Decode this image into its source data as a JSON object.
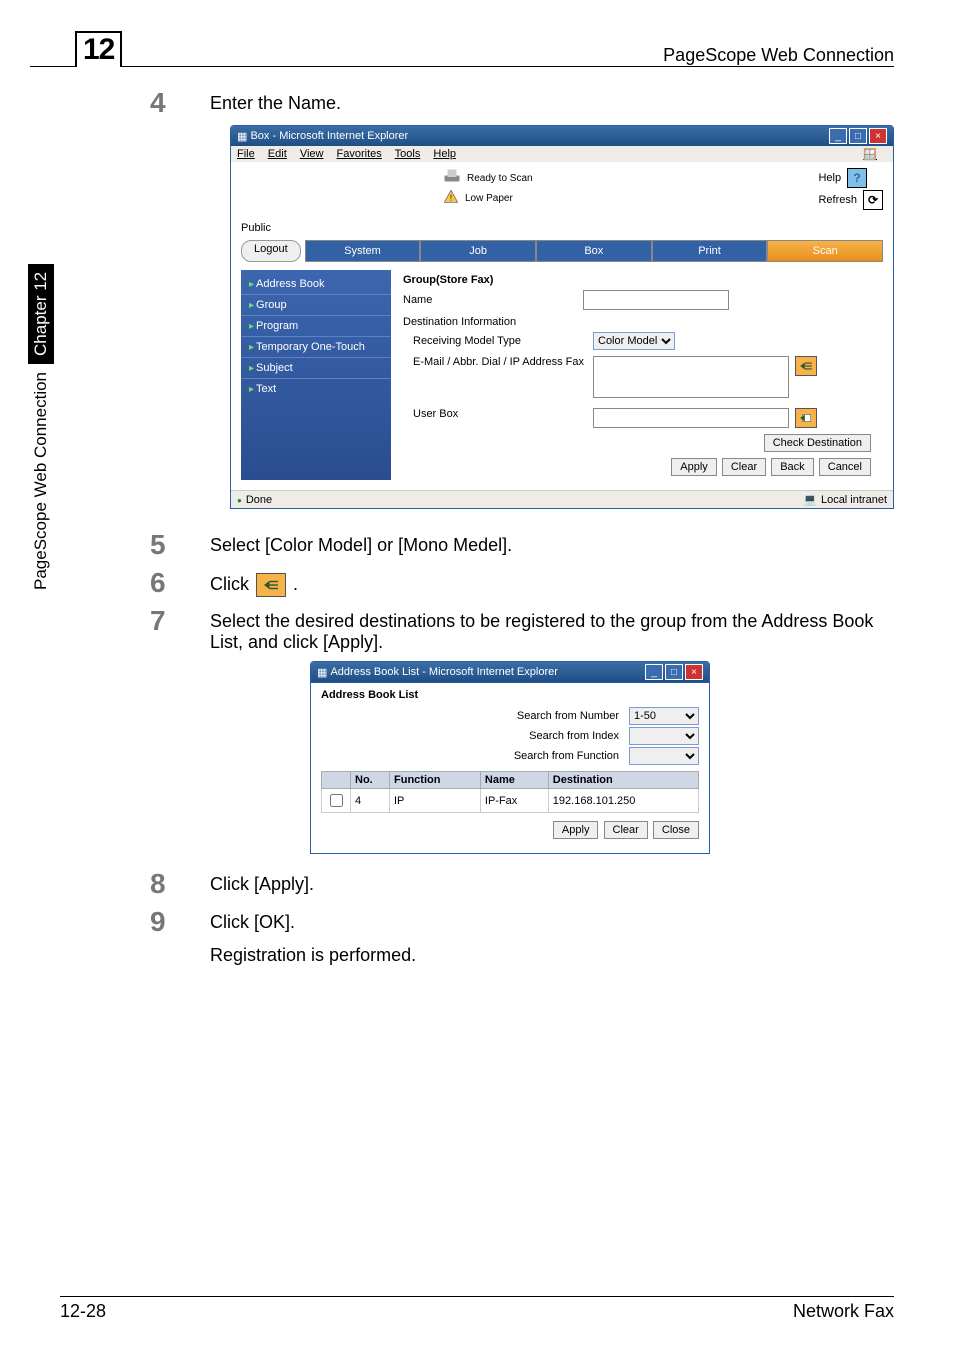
{
  "page": {
    "chapter_number": "12",
    "header_title": "PageScope Web Connection",
    "footer_left": "12-28",
    "footer_right": "Network Fax",
    "side_tab_text": "PageScope Web Connection",
    "side_tab_chapter": "Chapter 12"
  },
  "steps": {
    "s4": {
      "num": "4",
      "text": "Enter the Name."
    },
    "s5": {
      "num": "5",
      "text": "Select [Color Model] or [Mono Medel]."
    },
    "s6": {
      "num": "6",
      "pre": "Click ",
      "post": "."
    },
    "s7": {
      "num": "7",
      "text": "Select the desired destinations to be registered to the group from the Address Book List, and click [Apply]."
    },
    "s8": {
      "num": "8",
      "text": "Click [Apply]."
    },
    "s9": {
      "num": "9",
      "text1": "Click [OK].",
      "text2": "Registration is performed."
    }
  },
  "ie1": {
    "title": "Box - Microsoft Internet Explorer",
    "menu": {
      "file": "File",
      "edit": "Edit",
      "view": "View",
      "fav": "Favorites",
      "tools": "Tools",
      "help": "Help"
    },
    "status": {
      "ready": "Ready to Scan",
      "low": "Low Paper"
    },
    "links": {
      "help": "Help",
      "refresh": "Refresh"
    },
    "mode": "Public",
    "tabs": {
      "logout": "Logout",
      "system": "System",
      "job": "Job",
      "box": "Box",
      "print": "Print",
      "scan": "Scan"
    },
    "nav": {
      "addr": "Address Book",
      "group": "Group",
      "program": "Program",
      "temp": "Temporary One-Touch",
      "subject": "Subject",
      "text": "Text"
    },
    "form": {
      "title": "Group(Store Fax)",
      "name": "Name",
      "dest": "Destination Information",
      "model": "Receiving Model Type",
      "model_value": "Color Model",
      "abbr": "E-Mail / Abbr. Dial / IP Address Fax",
      "userbox": "User Box",
      "check": "Check Destination",
      "apply": "Apply",
      "clear": "Clear",
      "back": "Back",
      "cancel": "Cancel"
    },
    "statusbar": {
      "done": "Done",
      "zone": "Local intranet"
    }
  },
  "ie2": {
    "title": "Address Book List - Microsoft Internet Explorer",
    "heading": "Address Book List",
    "search_num": "Search from Number",
    "search_num_val": "1-50",
    "search_idx": "Search from Index",
    "search_fn": "Search from Function",
    "cols": {
      "no": "No.",
      "fn": "Function",
      "name": "Name",
      "dest": "Destination"
    },
    "row": {
      "no": "4",
      "fn": "IP",
      "name": "IP-Fax",
      "dest": "192.168.101.250"
    },
    "apply": "Apply",
    "clear": "Clear",
    "close": "Close"
  }
}
